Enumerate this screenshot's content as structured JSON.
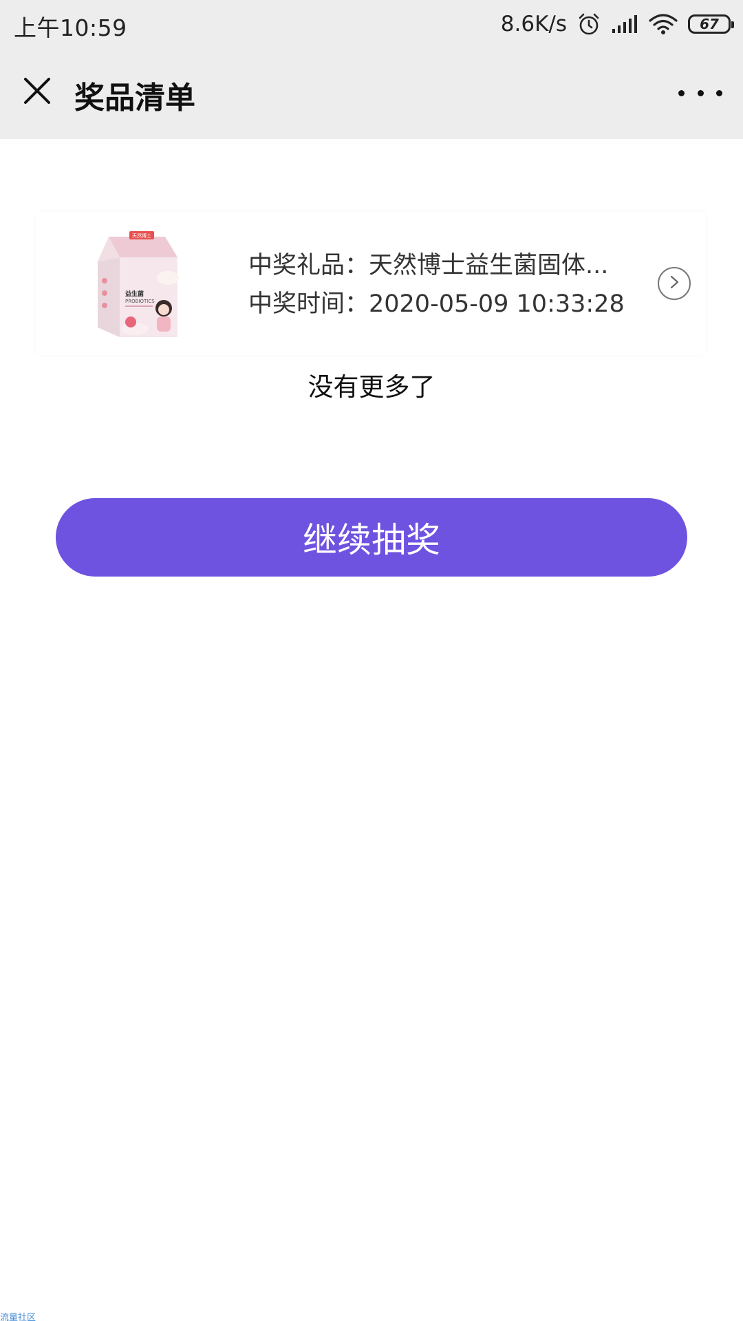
{
  "status_bar": {
    "time": "上午10:59",
    "net_speed": "8.6K/s",
    "battery_level": "67",
    "icons": [
      "alarm-icon",
      "signal-icon",
      "wifi-icon",
      "battery-icon"
    ]
  },
  "nav": {
    "title": "奖品清单",
    "close_icon": "close-icon",
    "more_icon": "more-icon"
  },
  "prize": {
    "gift_line": "中奖礼品：天然博士益生菌固体...",
    "time_line": "中奖时间：2020-05-09 10:33:28",
    "image_icon": "probiotics-box-image",
    "arrow_icon": "chevron-right-circle-icon",
    "package_texts": {
      "brand": "天然博士",
      "name_cn": "益生菌",
      "name_en": "PROBIOTICS"
    }
  },
  "list_end_text": "没有更多了",
  "continue_button": "继续抽奖",
  "watermark": "流量社区",
  "colors": {
    "accent": "#6e52e0",
    "bar_background": "#ededed",
    "background": "#ffffff"
  }
}
